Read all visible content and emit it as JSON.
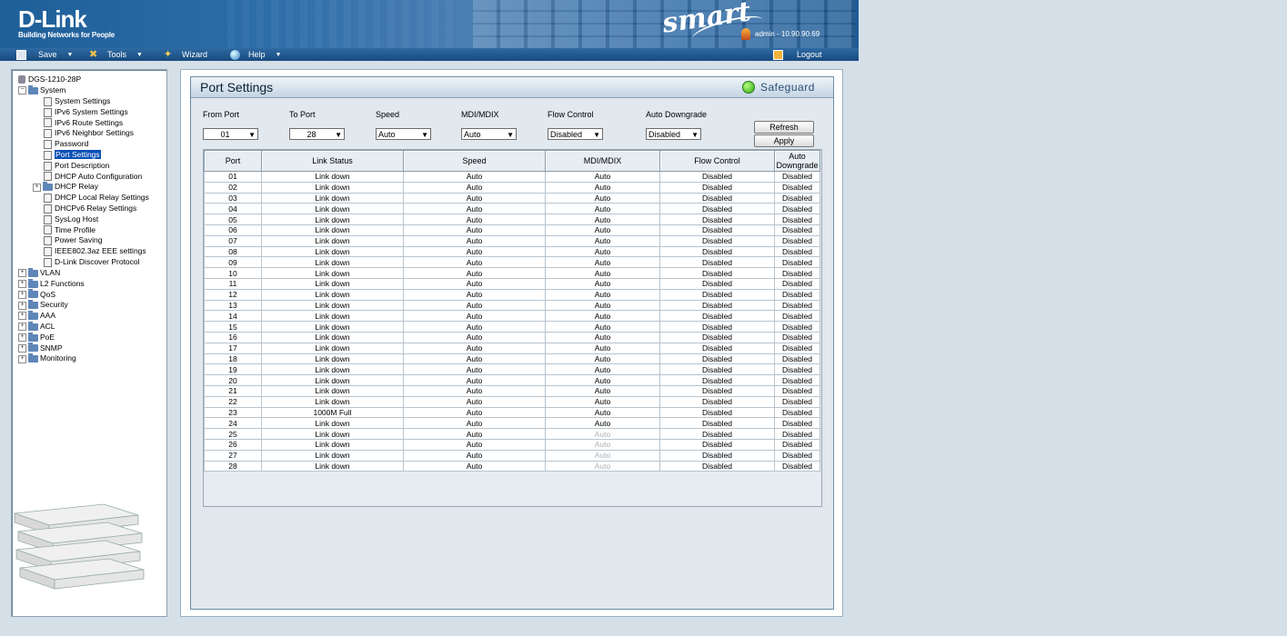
{
  "header": {
    "brand": "D-Link",
    "tagline": "Building Networks for People",
    "product": "smart",
    "user": "admin - 10.90.90.69"
  },
  "toolbar": {
    "save": "Save",
    "tools": "Tools",
    "wizard": "Wizard",
    "help": "Help",
    "logout": "Logout"
  },
  "sidebar": {
    "device": "DGS-1210-28P",
    "system": "System",
    "system_items": [
      "System Settings",
      "IPv6 System Settings",
      "IPv6 Route Settings",
      "IPv6 Neighbor Settings",
      "Password",
      "Port Settings",
      "Port Description",
      "DHCP Auto Configuration",
      "DHCP Relay",
      "DHCP Local Relay Settings",
      "DHCPv6 Relay Settings",
      "SysLog Host",
      "Time Profile",
      "Power Saving",
      "IEEE802.3az EEE settings",
      "D-Link Discover Protocol"
    ],
    "folders": [
      "VLAN",
      "L2 Functions",
      "QoS",
      "Security",
      "AAA",
      "ACL",
      "PoE",
      "SNMP",
      "Monitoring"
    ],
    "selected": "Port Settings"
  },
  "panel": {
    "title": "Port Settings",
    "safeguard": "Safeguard"
  },
  "form": {
    "labels": [
      "From Port",
      "To Port",
      "Speed",
      "MDI/MDIX",
      "Flow Control",
      "Auto Downgrade"
    ],
    "values": [
      "01",
      "28",
      "Auto",
      "Auto",
      "Disabled",
      "Disabled"
    ],
    "refresh": "Refresh",
    "apply": "Apply"
  },
  "table": {
    "headers": [
      "Port",
      "Link Status",
      "Speed",
      "MDI/MDIX",
      "Flow Control",
      "Auto Downgrade"
    ],
    "rows": [
      [
        "01",
        "Link down",
        "Auto",
        "Auto",
        "Disabled",
        "Disabled"
      ],
      [
        "02",
        "Link down",
        "Auto",
        "Auto",
        "Disabled",
        "Disabled"
      ],
      [
        "03",
        "Link down",
        "Auto",
        "Auto",
        "Disabled",
        "Disabled"
      ],
      [
        "04",
        "Link down",
        "Auto",
        "Auto",
        "Disabled",
        "Disabled"
      ],
      [
        "05",
        "Link down",
        "Auto",
        "Auto",
        "Disabled",
        "Disabled"
      ],
      [
        "06",
        "Link down",
        "Auto",
        "Auto",
        "Disabled",
        "Disabled"
      ],
      [
        "07",
        "Link down",
        "Auto",
        "Auto",
        "Disabled",
        "Disabled"
      ],
      [
        "08",
        "Link down",
        "Auto",
        "Auto",
        "Disabled",
        "Disabled"
      ],
      [
        "09",
        "Link down",
        "Auto",
        "Auto",
        "Disabled",
        "Disabled"
      ],
      [
        "10",
        "Link down",
        "Auto",
        "Auto",
        "Disabled",
        "Disabled"
      ],
      [
        "11",
        "Link down",
        "Auto",
        "Auto",
        "Disabled",
        "Disabled"
      ],
      [
        "12",
        "Link down",
        "Auto",
        "Auto",
        "Disabled",
        "Disabled"
      ],
      [
        "13",
        "Link down",
        "Auto",
        "Auto",
        "Disabled",
        "Disabled"
      ],
      [
        "14",
        "Link down",
        "Auto",
        "Auto",
        "Disabled",
        "Disabled"
      ],
      [
        "15",
        "Link down",
        "Auto",
        "Auto",
        "Disabled",
        "Disabled"
      ],
      [
        "16",
        "Link down",
        "Auto",
        "Auto",
        "Disabled",
        "Disabled"
      ],
      [
        "17",
        "Link down",
        "Auto",
        "Auto",
        "Disabled",
        "Disabled"
      ],
      [
        "18",
        "Link down",
        "Auto",
        "Auto",
        "Disabled",
        "Disabled"
      ],
      [
        "19",
        "Link down",
        "Auto",
        "Auto",
        "Disabled",
        "Disabled"
      ],
      [
        "20",
        "Link down",
        "Auto",
        "Auto",
        "Disabled",
        "Disabled"
      ],
      [
        "21",
        "Link down",
        "Auto",
        "Auto",
        "Disabled",
        "Disabled"
      ],
      [
        "22",
        "Link down",
        "Auto",
        "Auto",
        "Disabled",
        "Disabled"
      ],
      [
        "23",
        "1000M Full",
        "Auto",
        "Auto",
        "Disabled",
        "Disabled"
      ],
      [
        "24",
        "Link down",
        "Auto",
        "Auto",
        "Disabled",
        "Disabled"
      ],
      [
        "25",
        "Link down",
        "Auto",
        "Auto",
        "Disabled",
        "Disabled"
      ],
      [
        "26",
        "Link down",
        "Auto",
        "Auto",
        "Disabled",
        "Disabled"
      ],
      [
        "27",
        "Link down",
        "Auto",
        "Auto",
        "Disabled",
        "Disabled"
      ],
      [
        "28",
        "Link down",
        "Auto",
        "Auto",
        "Disabled",
        "Disabled"
      ]
    ],
    "dim_mdi_ports": [
      "25",
      "26",
      "27",
      "28"
    ]
  }
}
